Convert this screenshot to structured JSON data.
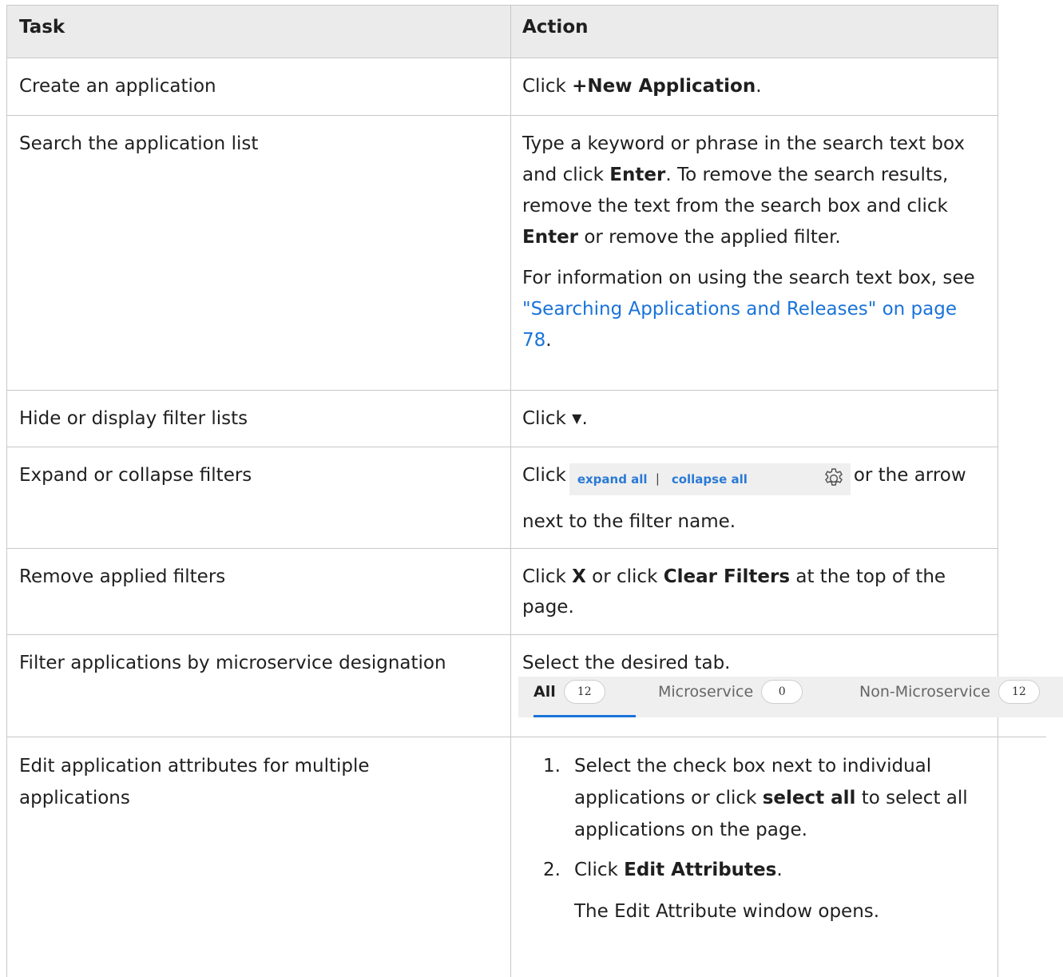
{
  "table": {
    "headers": {
      "task": "Task",
      "action": "Action"
    },
    "rows": {
      "create": {
        "task": "Create an application",
        "click": "Click ",
        "bold": "+New Application",
        "end": "."
      },
      "search": {
        "task": "Search the application list",
        "p1a": "Type a keyword or phrase in the search text box and click ",
        "b1": "Enter",
        "p1b": ". To remove the search results, remove the text from the search box and click ",
        "b2": "Enter",
        "p1c": " or remove the applied filter.",
        "p2a": "For information on using the search text box, see ",
        "link": "\"Searching Applications and Releases\" on page 78",
        "p2b": "."
      },
      "hide": {
        "task": "Hide or display filter lists",
        "click": "Click ",
        "glyph": "▼",
        "end": "."
      },
      "expand": {
        "task": "Expand or collapse filters",
        "click": "Click",
        "expand_all": "expand all",
        "sep": "|",
        "collapse_all": "collapse all",
        "gear_icon": "gear-icon",
        "rest1": "or the arrow",
        "rest2": "next to the filter name."
      },
      "remove": {
        "task": "Remove applied filters",
        "click": "Click ",
        "x": "X",
        "mid": " or click ",
        "clear": "Clear Filters",
        "end": " at the top of the page."
      },
      "micro": {
        "task": "Filter applications by microservice designation",
        "action": "Select the desired tab.",
        "tabs": [
          {
            "label": "All",
            "count": "12"
          },
          {
            "label": "Microservice",
            "count": "0"
          },
          {
            "label": "Non-Microservice",
            "count": "12"
          }
        ]
      },
      "edit": {
        "task": "Edit application attributes for multiple applications",
        "step1_num": "1.",
        "step1a": "Select the check box next to individual applications or click ",
        "step1b": "select all",
        "step1c": " to select all applications on the page.",
        "step2_num": "2.",
        "step2a": "Click ",
        "step2b": "Edit Attributes",
        "step2c": ".",
        "step2_note": "The Edit Attribute window opens."
      }
    }
  },
  "colors": {
    "header_bg": "#ebebeb",
    "border": "#c8c8c8",
    "link": "#1a73d9",
    "tab_underline": "#1a73d9"
  }
}
